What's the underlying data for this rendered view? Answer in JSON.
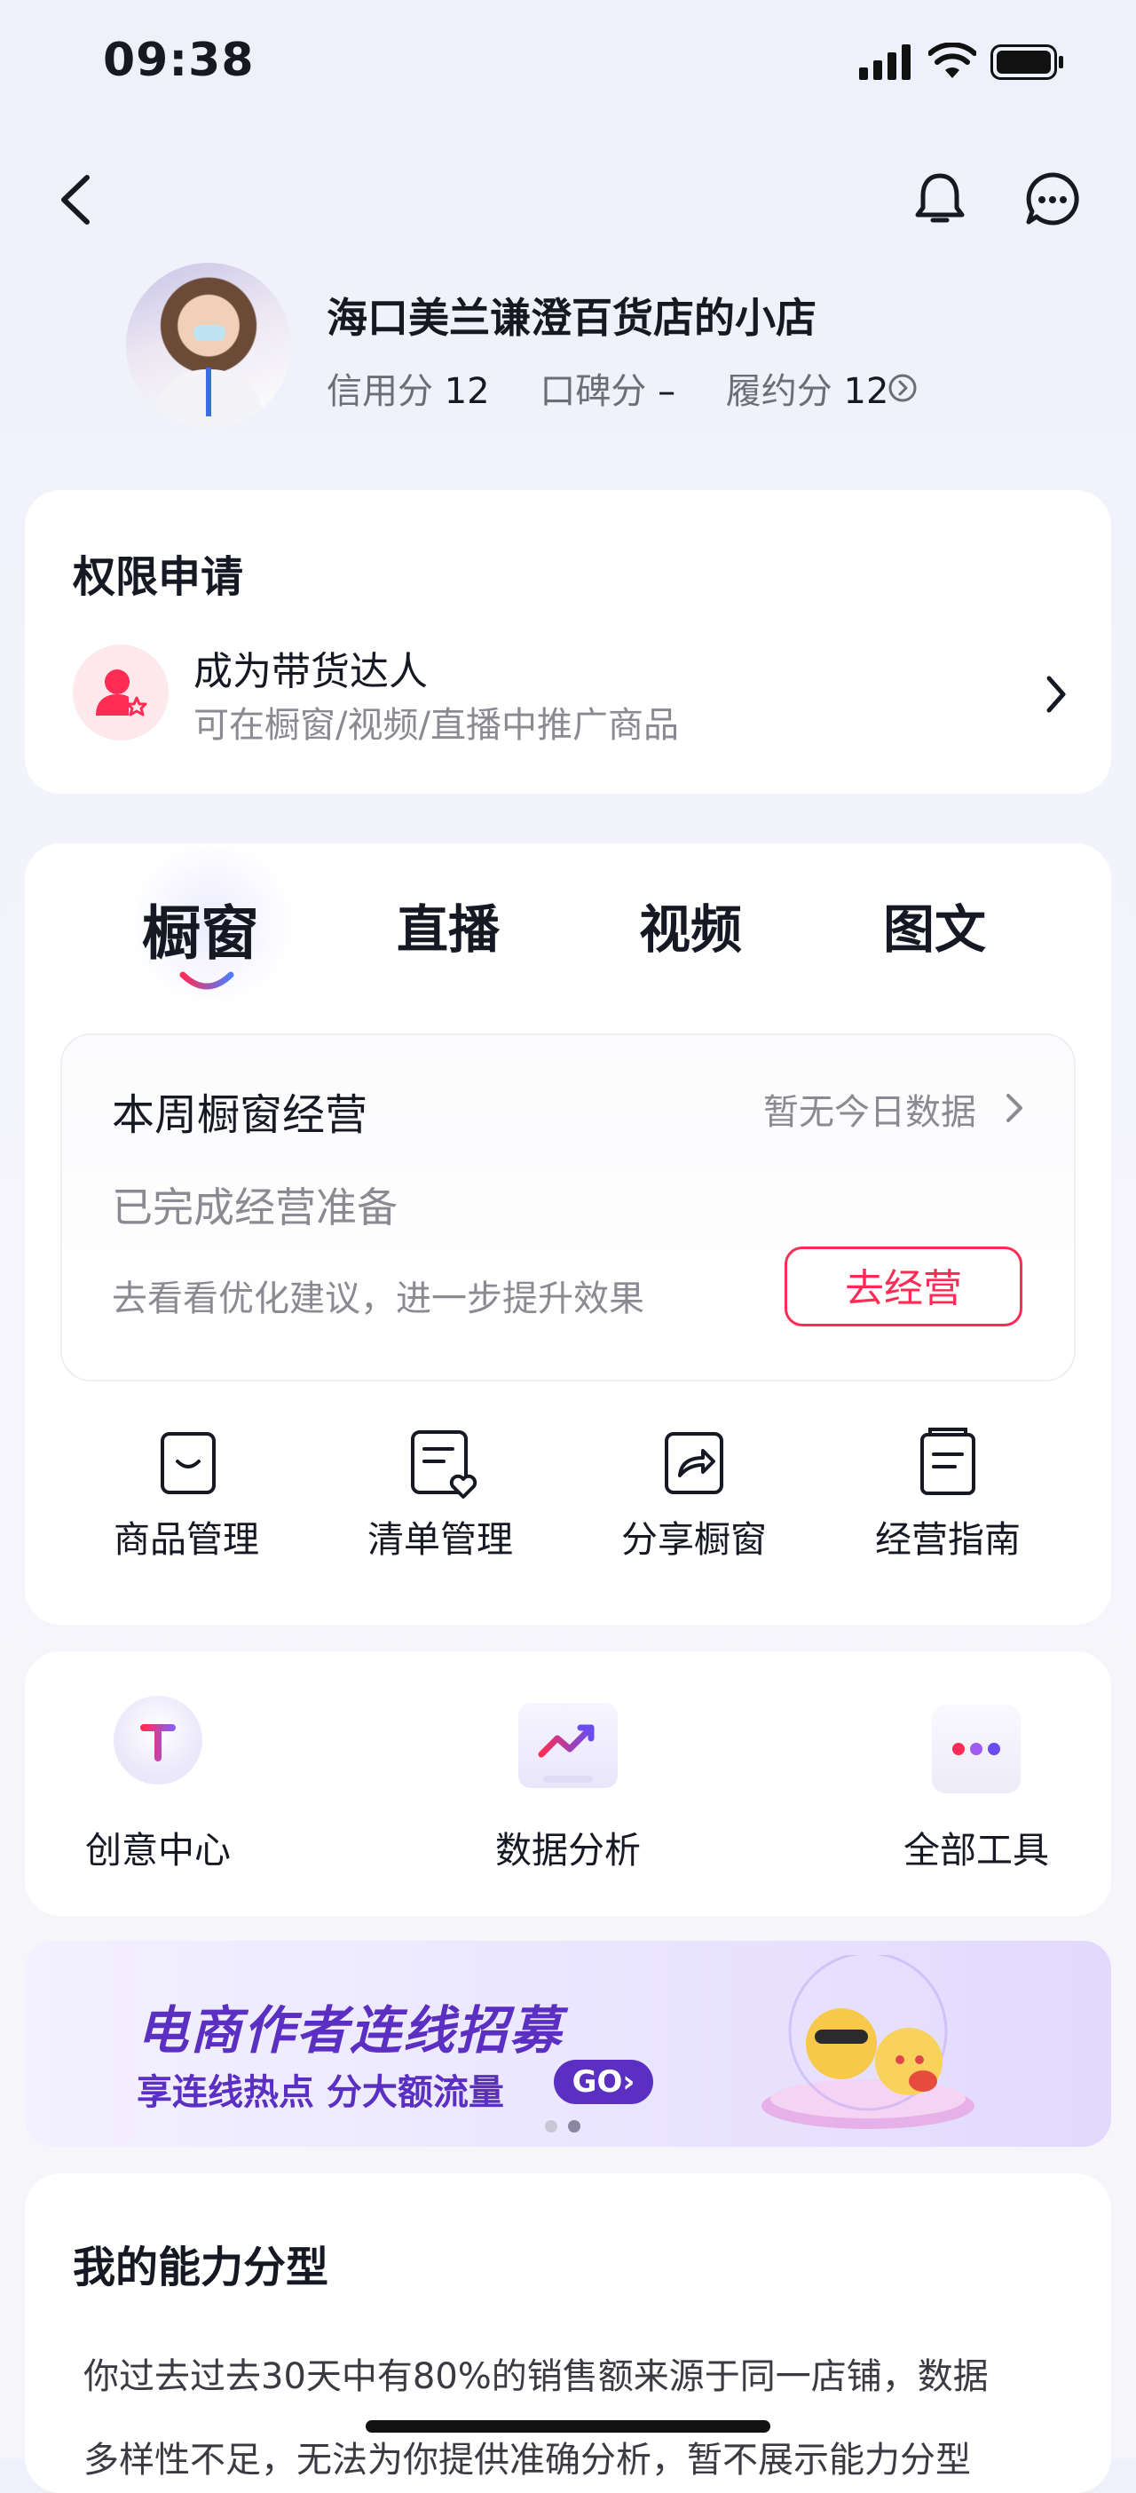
{
  "status_bar": {
    "time": "09:38"
  },
  "profile": {
    "shop_name": "海口美兰谦澄百货店的小店",
    "credit_label": "信用分",
    "credit_value": "12",
    "reputation_label": "口碑分",
    "reputation_value": "–",
    "fulfillment_label": "履约分",
    "fulfillment_value": "12"
  },
  "permission": {
    "title": "权限申请",
    "item_title": "成为带货达人",
    "item_desc": "可在橱窗/视频/直播中推广商品"
  },
  "tabs": [
    {
      "label": "橱窗",
      "active": true
    },
    {
      "label": "直播",
      "active": false
    },
    {
      "label": "视频",
      "active": false
    },
    {
      "label": "图文",
      "active": false
    }
  ],
  "weekly": {
    "title": "本周橱窗经营",
    "no_data": "暂无今日数据",
    "status": "已完成经营准备",
    "suggestion": "去看看优化建议，进一步提升效果",
    "action": "去经营"
  },
  "tools": [
    {
      "label": "商品管理",
      "icon": "product-box-icon"
    },
    {
      "label": "清单管理",
      "icon": "list-heart-icon"
    },
    {
      "label": "分享橱窗",
      "icon": "share-icon"
    },
    {
      "label": "经营指南",
      "icon": "guide-book-icon"
    }
  ],
  "tools2": [
    {
      "label": "创意中心",
      "icon": "creative-t-icon"
    },
    {
      "label": "数据分析",
      "icon": "data-chart-icon"
    },
    {
      "label": "全部工具",
      "icon": "all-tools-dots-icon"
    }
  ],
  "banner": {
    "title": "电商作者连线招募",
    "subtitle": "享连线热点 分大额流量",
    "go": "GO›"
  },
  "ability": {
    "title": "我的能力分型",
    "text_line1": "你过去过去30天中有80%的销售额来源于同一店铺，数据",
    "text_line2": "多样性不足，无法为你提供准确分析，暂不展示能力分型"
  },
  "colors": {
    "accent_red": "#fe2c55",
    "banner_purple": "#5a2fc2"
  }
}
